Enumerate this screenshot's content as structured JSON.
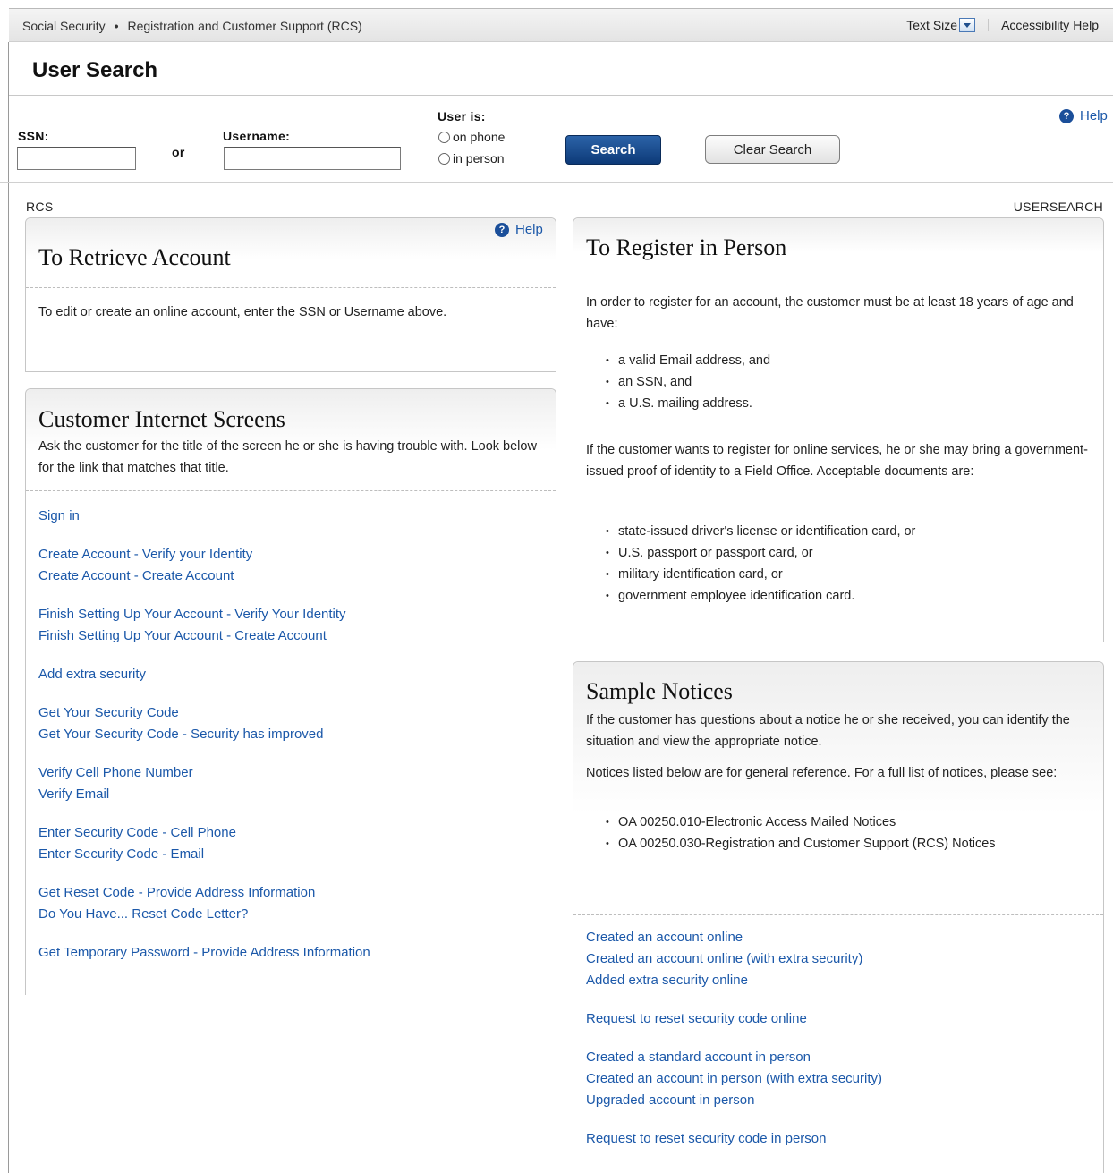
{
  "topbar": {
    "crumb1": "Social Security",
    "separator": "•",
    "crumb2": "Registration and Customer Support (RCS)",
    "text_size": "Text Size",
    "accessibility": "Accessibility Help"
  },
  "page_title": "User Search",
  "search": {
    "ssn_label": "SSN:",
    "ssn_value": "",
    "or_label": "or",
    "username_label": "Username:",
    "username_value": "",
    "user_is_label": "User is:",
    "option_phone": "on phone",
    "option_person": "in person",
    "search_button": "Search",
    "clear_button": "Clear Search",
    "help": "Help"
  },
  "labels": {
    "left": "RCS",
    "right": "USERSEARCH"
  },
  "retrieve": {
    "help": "Help",
    "title": "To Retrieve Account",
    "text": "To edit or create an online account, enter the SSN or Username above."
  },
  "customer_screens": {
    "title": "Customer Internet Screens",
    "text": "Ask the customer for the title of the screen he or she is having trouble with. Look below for the link that matches that title.",
    "groups": [
      [
        "Sign in"
      ],
      [
        "Create Account - Verify your Identity",
        "Create Account - Create Account"
      ],
      [
        "Finish Setting Up Your Account - Verify Your Identity",
        "Finish Setting Up Your Account - Create Account"
      ],
      [
        "Add extra security"
      ],
      [
        "Get Your Security Code",
        "Get Your Security Code - Security has improved"
      ],
      [
        "Verify Cell Phone Number",
        "Verify Email"
      ],
      [
        "Enter Security Code - Cell Phone",
        "Enter Security Code - Email"
      ],
      [
        "Get Reset Code - Provide Address Information",
        "Do You Have... Reset Code Letter?"
      ],
      [
        "Get Temporary Password - Provide Address Information"
      ]
    ]
  },
  "register": {
    "title": "To Register in Person",
    "intro": "In order to register for an account, the customer must be at least 18 years of age and have:",
    "requirements": [
      "a valid Email address, and",
      "an SSN, and",
      "a U.S. mailing address."
    ],
    "para2": "If the customer wants to register for online services, he or she may bring a government-issued proof of identity to a Field Office. Acceptable documents are:",
    "documents": [
      "state-issued driver's license or identification card, or",
      "U.S. passport or passport card, or",
      "military identification card, or",
      "government employee identification card."
    ]
  },
  "notices": {
    "title": "Sample Notices",
    "intro": "If the customer has questions about a notice he or she received, you can identify the situation and view the appropriate notice.",
    "para2": "Notices listed below are for general reference. For a full list of notices, please see:",
    "references": [
      "OA 00250.010-Electronic Access Mailed Notices",
      "OA 00250.030-Registration and Customer Support (RCS) Notices"
    ],
    "groups": [
      [
        "Created an account online",
        "Created an account online (with extra security)",
        "Added extra security online"
      ],
      [
        "Request to reset security code online"
      ],
      [
        "Created a standard account in person",
        "Created an account in person (with extra security)",
        "Upgraded account in person"
      ],
      [
        "Request to reset security code in person"
      ]
    ]
  }
}
